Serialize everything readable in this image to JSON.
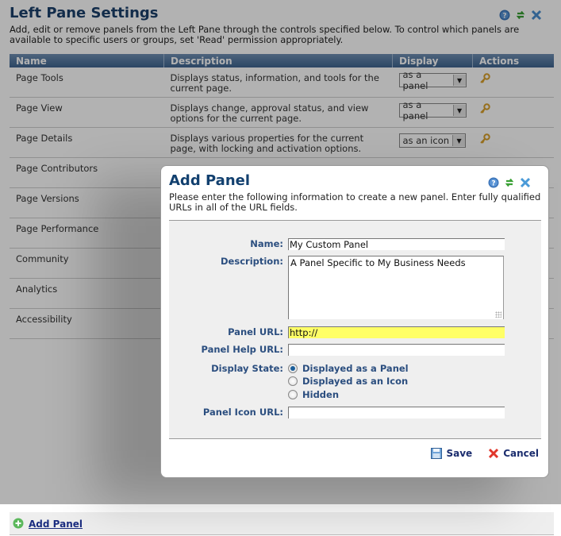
{
  "page": {
    "title": "Left Pane Settings",
    "intro": "Add, edit or remove panels from the Left Pane through the controls specified below. To control which panels are available to specific users or groups, set 'Read' permission appropriately.",
    "header_icons": [
      "help-icon",
      "refresh-icon",
      "close-icon"
    ]
  },
  "table": {
    "columns": [
      "Name",
      "Description",
      "Display",
      "Actions"
    ],
    "rows": [
      {
        "name": "Page Tools",
        "description": "Displays status, information, and tools for the current page.",
        "display": "as a panel",
        "action_icon": "key-icon"
      },
      {
        "name": "Page View",
        "description": "Displays change, approval status, and view options for the current page.",
        "display": "as a panel",
        "action_icon": "key-icon"
      },
      {
        "name": "Page Details",
        "description": "Displays various properties for the current page, with locking and activation options.",
        "display": "as an icon",
        "action_icon": "key-icon"
      },
      {
        "name": "Page Contributors"
      },
      {
        "name": "Page Versions"
      },
      {
        "name": "Page Performance"
      },
      {
        "name": "Community"
      },
      {
        "name": "Analytics"
      },
      {
        "name": "Accessibility"
      }
    ]
  },
  "footer": {
    "add_panel_label": "Add Panel"
  },
  "dialog": {
    "title": "Add Panel",
    "intro": "Please enter the following information to create a new panel. Enter fully qualified URLs in all of the URL fields.",
    "fields": {
      "name_label": "Name:",
      "name_value": "My Custom Panel",
      "description_label": "Description:",
      "description_value": "A Panel Specific to My Business Needs",
      "panel_url_label": "Panel URL:",
      "panel_url_value": "http://",
      "panel_help_url_label": "Panel Help URL:",
      "panel_help_url_value": "",
      "display_state_label": "Display State:",
      "display_state_options": [
        "Displayed as a Panel",
        "Displayed as an Icon",
        "Hidden"
      ],
      "display_state_selected": "Displayed as a Panel",
      "panel_icon_url_label": "Panel Icon URL:",
      "panel_icon_url_value": ""
    },
    "save_label": "Save",
    "cancel_label": "Cancel"
  },
  "colors": {
    "title": "#1b3f6b",
    "header_bar": "#3f6490",
    "label": "#2b4e7f",
    "highlight_field": "#ffff66",
    "link": "#1b2d80"
  }
}
